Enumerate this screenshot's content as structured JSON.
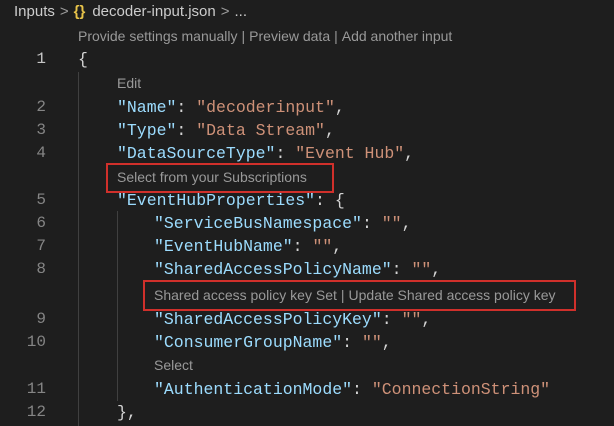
{
  "breadcrumb": {
    "root": "Inputs",
    "separator": ">",
    "file_icon": "{}",
    "file": "decoder-input.json",
    "tail": "..."
  },
  "codelens": {
    "top": [
      "Provide settings manually",
      "Preview data",
      "Add another input"
    ],
    "edit": "Edit",
    "subscriptions": "Select from your Subscriptions",
    "policy_key": [
      "Shared access policy key Set",
      "Update Shared access policy key"
    ],
    "select": "Select",
    "separator": "|"
  },
  "lines": [
    {
      "num": "1",
      "key": "",
      "value": "",
      "suffix": "{"
    },
    {
      "num": "2",
      "key": "\"Name\"",
      "value": "\"decoderinput\"",
      "suffix": ","
    },
    {
      "num": "3",
      "key": "\"Type\"",
      "value": "\"Data Stream\"",
      "suffix": ","
    },
    {
      "num": "4",
      "key": "\"DataSourceType\"",
      "value": "\"Event Hub\"",
      "suffix": ","
    },
    {
      "num": "5",
      "key": "\"EventHubProperties\"",
      "value": "",
      "suffix": "{"
    },
    {
      "num": "6",
      "key": "\"ServiceBusNamespace\"",
      "value": "\"\"",
      "suffix": ","
    },
    {
      "num": "7",
      "key": "\"EventHubName\"",
      "value": "\"\"",
      "suffix": ","
    },
    {
      "num": "8",
      "key": "\"SharedAccessPolicyName\"",
      "value": "\"\"",
      "suffix": ","
    },
    {
      "num": "9",
      "key": "\"SharedAccessPolicyKey\"",
      "value": "\"\"",
      "suffix": ","
    },
    {
      "num": "10",
      "key": "\"ConsumerGroupName\"",
      "value": "\"\"",
      "suffix": ","
    },
    {
      "num": "11",
      "key": "\"AuthenticationMode\"",
      "value": "\"ConnectionString\"",
      "suffix": ""
    },
    {
      "num": "12",
      "key": "",
      "value": "",
      "suffix": "},"
    }
  ],
  "colon": ":",
  "colors": {
    "background": "#1e1e1e",
    "key": "#9cdcfe",
    "string": "#ce9178",
    "highlight_box": "#d0302b",
    "codelens": "#999999"
  }
}
